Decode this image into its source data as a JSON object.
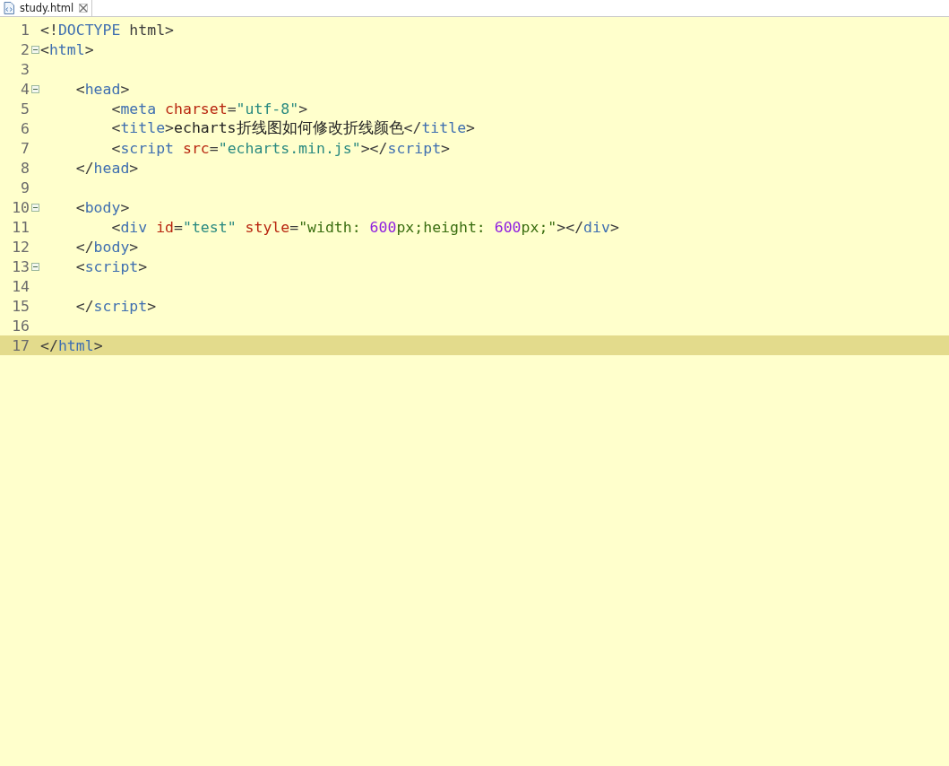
{
  "tabs": [
    {
      "label": "study.html",
      "selected": true
    }
  ],
  "editor": {
    "lines": [
      {
        "number": "1",
        "foldable": false,
        "current": false,
        "tokens": [
          {
            "kind": "punct",
            "text": "<!"
          },
          {
            "kind": "tag",
            "text": "DOCTYPE"
          },
          {
            "kind": "punct",
            "text": " html>"
          }
        ]
      },
      {
        "number": "2",
        "foldable": true,
        "current": false,
        "tokens": [
          {
            "kind": "punct",
            "text": "<"
          },
          {
            "kind": "tag",
            "text": "html"
          },
          {
            "kind": "punct",
            "text": ">"
          }
        ]
      },
      {
        "number": "3",
        "foldable": false,
        "current": false
      },
      {
        "number": "4",
        "foldable": true,
        "current": false,
        "tokens": [
          {
            "kind": "punct",
            "text": "    <"
          },
          {
            "kind": "tag",
            "text": "head"
          },
          {
            "kind": "punct",
            "text": ">"
          }
        ]
      },
      {
        "number": "5",
        "foldable": false,
        "current": false,
        "tokens": [
          {
            "kind": "punct",
            "text": "        <"
          },
          {
            "kind": "tag",
            "text": "meta"
          },
          {
            "kind": "attr",
            "text": " charset"
          },
          {
            "kind": "punct",
            "text": "="
          },
          {
            "kind": "string",
            "text": "\"utf-8\""
          },
          {
            "kind": "punct",
            "text": ">"
          }
        ]
      },
      {
        "number": "6",
        "foldable": false,
        "current": false,
        "tokens": [
          {
            "kind": "punct",
            "text": "        <"
          },
          {
            "kind": "tag",
            "text": "title"
          },
          {
            "kind": "punct",
            "text": ">"
          },
          {
            "kind": "text",
            "text": "echarts折线图如何修改折线颜色"
          },
          {
            "kind": "punct",
            "text": "</"
          },
          {
            "kind": "tag",
            "text": "title"
          },
          {
            "kind": "punct",
            "text": ">"
          }
        ]
      },
      {
        "number": "7",
        "foldable": false,
        "current": false,
        "tokens": [
          {
            "kind": "punct",
            "text": "        <"
          },
          {
            "kind": "tag",
            "text": "script"
          },
          {
            "kind": "attr",
            "text": " src"
          },
          {
            "kind": "punct",
            "text": "="
          },
          {
            "kind": "string",
            "text": "\"echarts.min.js\""
          },
          {
            "kind": "punct",
            "text": "></"
          },
          {
            "kind": "tag",
            "text": "script"
          },
          {
            "kind": "punct",
            "text": ">"
          }
        ]
      },
      {
        "number": "8",
        "foldable": false,
        "current": false,
        "tokens": [
          {
            "kind": "punct",
            "text": "    </"
          },
          {
            "kind": "tag",
            "text": "head"
          },
          {
            "kind": "punct",
            "text": ">"
          }
        ]
      },
      {
        "number": "9",
        "foldable": false,
        "current": false
      },
      {
        "number": "10",
        "foldable": true,
        "current": false,
        "tokens": [
          {
            "kind": "punct",
            "text": "    <"
          },
          {
            "kind": "tag",
            "text": "body"
          },
          {
            "kind": "punct",
            "text": ">"
          }
        ]
      },
      {
        "number": "11",
        "foldable": false,
        "current": false,
        "tokens": [
          {
            "kind": "punct",
            "text": "        <"
          },
          {
            "kind": "tag",
            "text": "div"
          },
          {
            "kind": "attr",
            "text": " id"
          },
          {
            "kind": "punct",
            "text": "="
          },
          {
            "kind": "string",
            "text": "\"test\""
          },
          {
            "kind": "attr",
            "text": " style"
          },
          {
            "kind": "punct",
            "text": "="
          },
          {
            "kind": "css",
            "text": "\"width: "
          },
          {
            "kind": "number",
            "text": "600"
          },
          {
            "kind": "css",
            "text": "px;height: "
          },
          {
            "kind": "number",
            "text": "600"
          },
          {
            "kind": "css",
            "text": "px;\""
          },
          {
            "kind": "punct",
            "text": "></"
          },
          {
            "kind": "tag",
            "text": "div"
          },
          {
            "kind": "punct",
            "text": ">"
          }
        ]
      },
      {
        "number": "12",
        "foldable": false,
        "current": false,
        "tokens": [
          {
            "kind": "punct",
            "text": "    </"
          },
          {
            "kind": "tag",
            "text": "body"
          },
          {
            "kind": "punct",
            "text": ">"
          }
        ]
      },
      {
        "number": "13",
        "foldable": true,
        "current": false,
        "tokens": [
          {
            "kind": "punct",
            "text": "    <"
          },
          {
            "kind": "tag",
            "text": "script"
          },
          {
            "kind": "punct",
            "text": ">"
          }
        ]
      },
      {
        "number": "14",
        "foldable": false,
        "current": false
      },
      {
        "number": "15",
        "foldable": false,
        "current": false,
        "tokens": [
          {
            "kind": "punct",
            "text": "    </"
          },
          {
            "kind": "tag",
            "text": "script"
          },
          {
            "kind": "punct",
            "text": ">"
          }
        ]
      },
      {
        "number": "16",
        "foldable": false,
        "current": false
      },
      {
        "number": "17",
        "foldable": false,
        "current": true,
        "tokens": [
          {
            "kind": "punct",
            "text": "</"
          },
          {
            "kind": "tag",
            "text": "html"
          },
          {
            "kind": "punct",
            "text": ">"
          }
        ]
      }
    ]
  }
}
